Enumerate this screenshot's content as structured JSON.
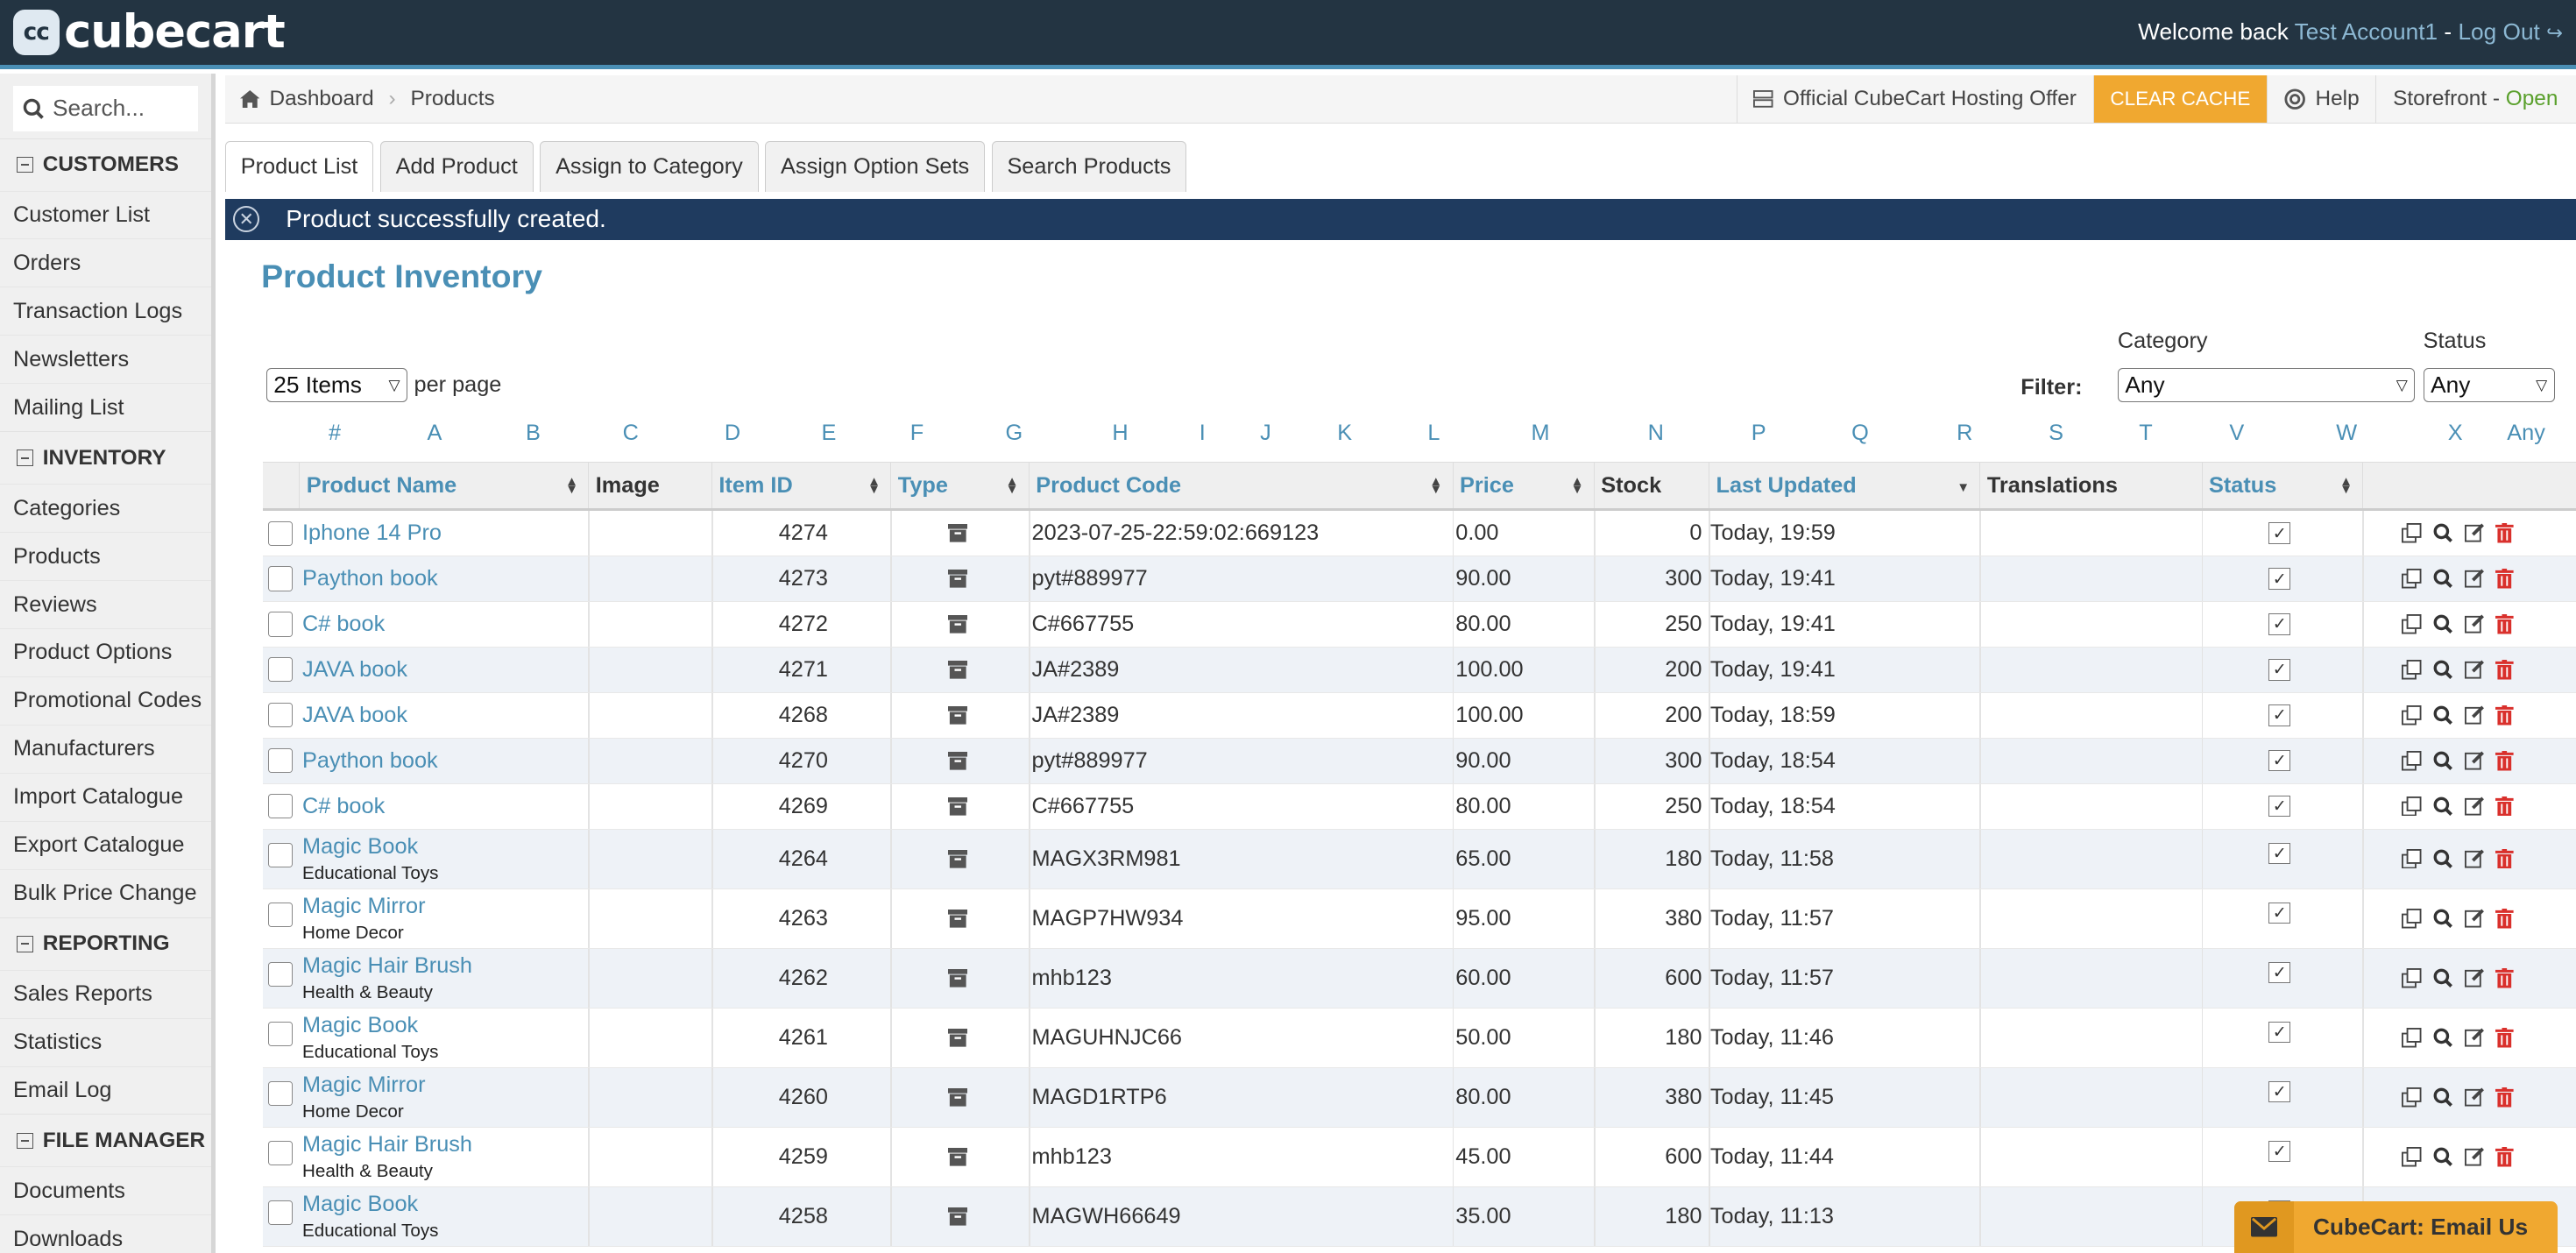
{
  "app": {
    "logo_text": "cubecart",
    "logo_mark": "cc"
  },
  "topbar": {
    "welcome": "Welcome back",
    "account": "Test Account1",
    "separator": "-",
    "logout": "Log Out"
  },
  "sidebar": {
    "search_placeholder": "Search...",
    "sections": [
      {
        "title": "CUSTOMERS",
        "items": [
          "Customer List",
          "Orders",
          "Transaction Logs",
          "Newsletters",
          "Mailing List"
        ]
      },
      {
        "title": "INVENTORY",
        "items": [
          "Categories",
          "Products",
          "Reviews",
          "Product Options",
          "Promotional Codes",
          "Manufacturers",
          "Import Catalogue",
          "Export Catalogue",
          "Bulk Price Change"
        ]
      },
      {
        "title": "REPORTING",
        "items": [
          "Sales Reports",
          "Statistics",
          "Email Log"
        ]
      },
      {
        "title": "FILE MANAGER",
        "items": [
          "Documents",
          "Downloads"
        ]
      }
    ]
  },
  "breadcrumb": {
    "home": "Dashboard",
    "current": "Products"
  },
  "header_right": {
    "hosting": "Official CubeCart Hosting Offer",
    "clear_cache": "CLEAR CACHE",
    "help": "Help",
    "storefront": "Storefront -",
    "storefront_status": "Open"
  },
  "tabs": [
    "Product List",
    "Add Product",
    "Assign to Category",
    "Assign Option Sets",
    "Search Products"
  ],
  "alert": {
    "message": "Product successfully created."
  },
  "page": {
    "title": "Product Inventory"
  },
  "filters": {
    "per_page_value": "25 Items",
    "per_page_label": "per page",
    "filter_label": "Filter:",
    "category_label": "Category",
    "category_value": "Any",
    "status_label": "Status",
    "status_value": "Any"
  },
  "letters": [
    "#",
    "A",
    "B",
    "C",
    "D",
    "E",
    "F",
    "G",
    "H",
    "I",
    "J",
    "K",
    "L",
    "M",
    "N",
    "P",
    "Q",
    "R",
    "S",
    "T",
    "V",
    "W",
    "X",
    "Any"
  ],
  "table": {
    "columns": {
      "name": "Product Name",
      "image": "Image",
      "item_id": "Item ID",
      "type": "Type",
      "code": "Product Code",
      "price": "Price",
      "stock": "Stock",
      "updated": "Last Updated",
      "translations": "Translations",
      "status": "Status"
    },
    "rows": [
      {
        "name": "Iphone 14 Pro",
        "category": "",
        "id": "4274",
        "code": "2023-07-25-22:59:02:669123",
        "price": "0.00",
        "stock": "0",
        "updated": "Today, 19:59"
      },
      {
        "name": "Paython book",
        "category": "",
        "id": "4273",
        "code": "pyt#889977",
        "price": "90.00",
        "stock": "300",
        "updated": "Today, 19:41"
      },
      {
        "name": "C# book",
        "category": "",
        "id": "4272",
        "code": "C#667755",
        "price": "80.00",
        "stock": "250",
        "updated": "Today, 19:41"
      },
      {
        "name": "JAVA book",
        "category": "",
        "id": "4271",
        "code": "JA#2389",
        "price": "100.00",
        "stock": "200",
        "updated": "Today, 19:41"
      },
      {
        "name": "JAVA book",
        "category": "",
        "id": "4268",
        "code": "JA#2389",
        "price": "100.00",
        "stock": "200",
        "updated": "Today, 18:59"
      },
      {
        "name": "Paython book",
        "category": "",
        "id": "4270",
        "code": "pyt#889977",
        "price": "90.00",
        "stock": "300",
        "updated": "Today, 18:54"
      },
      {
        "name": "C# book",
        "category": "",
        "id": "4269",
        "code": "C#667755",
        "price": "80.00",
        "stock": "250",
        "updated": "Today, 18:54"
      },
      {
        "name": "Magic Book",
        "category": "Educational Toys",
        "id": "4264",
        "code": "MAGX3RM981",
        "price": "65.00",
        "stock": "180",
        "updated": "Today, 11:58"
      },
      {
        "name": "Magic Mirror",
        "category": "Home Decor",
        "id": "4263",
        "code": "MAGP7HW934",
        "price": "95.00",
        "stock": "380",
        "updated": "Today, 11:57"
      },
      {
        "name": "Magic Hair Brush",
        "category": "Health & Beauty",
        "id": "4262",
        "code": "mhb123",
        "price": "60.00",
        "stock": "600",
        "updated": "Today, 11:57"
      },
      {
        "name": "Magic Book",
        "category": "Educational Toys",
        "id": "4261",
        "code": "MAGUHNJC66",
        "price": "50.00",
        "stock": "180",
        "updated": "Today, 11:46"
      },
      {
        "name": "Magic Mirror",
        "category": "Home Decor",
        "id": "4260",
        "code": "MAGD1RTP6",
        "price": "80.00",
        "stock": "380",
        "updated": "Today, 11:45"
      },
      {
        "name": "Magic Hair Brush",
        "category": "Health & Beauty",
        "id": "4259",
        "code": "mhb123",
        "price": "45.00",
        "stock": "600",
        "updated": "Today, 11:44"
      },
      {
        "name": "Magic Book",
        "category": "Educational Toys",
        "id": "4258",
        "code": "MAGWH66649",
        "price": "35.00",
        "stock": "180",
        "updated": "Today, 11:13"
      }
    ]
  },
  "email_widget": {
    "label": "CubeCart: Email Us"
  },
  "colors": {
    "topbar": "#233442",
    "accent": "#4a8fb5",
    "alert": "#1f3b5f",
    "cache_button": "#f0a830",
    "delete_icon": "#d9302c"
  }
}
